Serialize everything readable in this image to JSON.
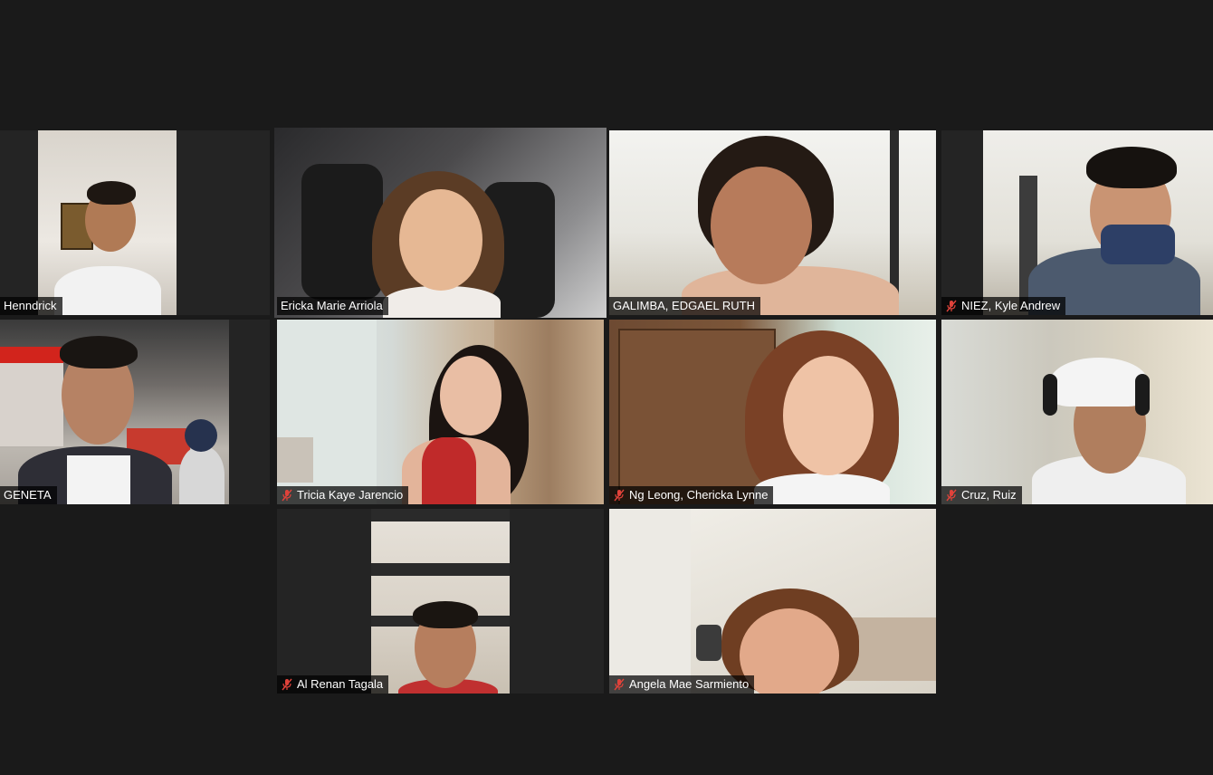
{
  "participants": [
    {
      "name": "Henndrick",
      "muted": false,
      "active": false
    },
    {
      "name": "Ericka Marie Arriola",
      "muted": false,
      "active": true
    },
    {
      "name": "GALIMBA, EDGAEL RUTH",
      "muted": false,
      "active": false
    },
    {
      "name": "NIEZ, Kyle Andrew",
      "muted": true,
      "active": false
    },
    {
      "name": "GENETA",
      "muted": false,
      "active": false
    },
    {
      "name": "Tricia Kaye Jarencio",
      "muted": true,
      "active": false
    },
    {
      "name": "Ng Leong, Chericka Lynne",
      "muted": true,
      "active": false
    },
    {
      "name": "Cruz, Ruiz",
      "muted": true,
      "active": false
    },
    {
      "name": "Al Renan Tagala",
      "muted": true,
      "active": false
    },
    {
      "name": "Angela Mae Sarmiento",
      "muted": true,
      "active": false
    }
  ],
  "colors": {
    "background": "#1a1a1a",
    "active_speaker_border": "#d6e98a",
    "mute_icon": "#e0423a"
  },
  "icons": {
    "mute": "microphone-muted-icon"
  }
}
